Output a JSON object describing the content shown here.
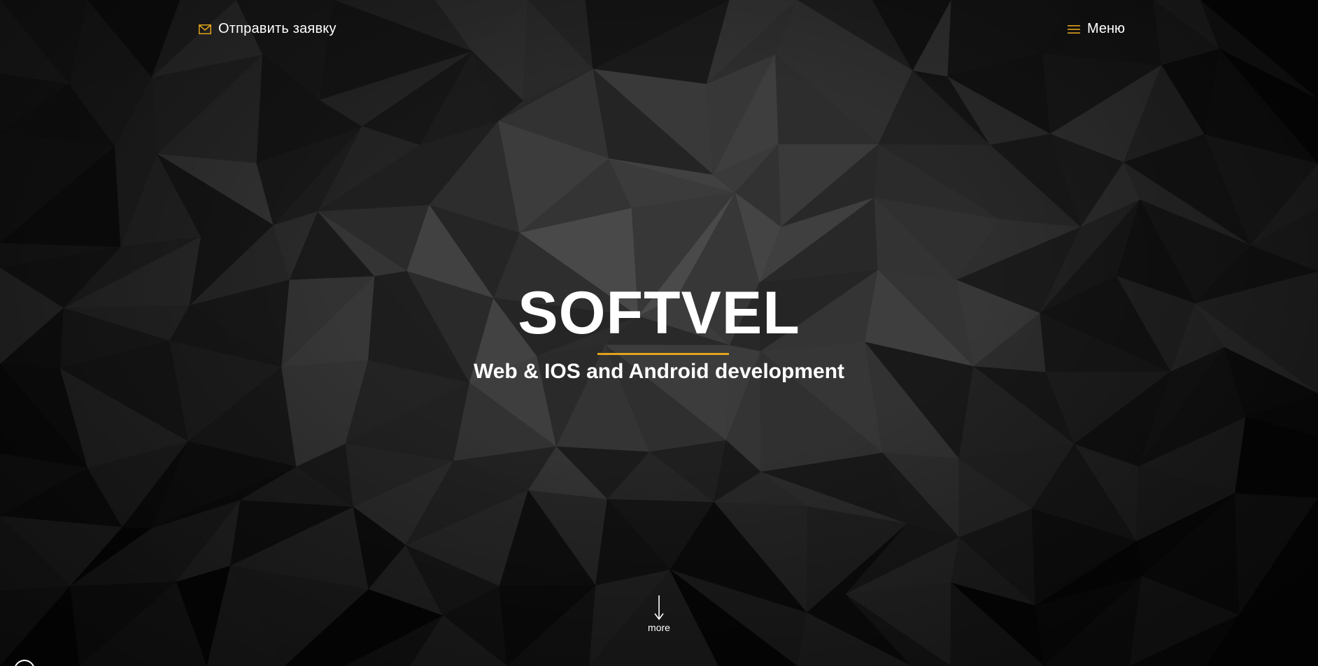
{
  "header": {
    "request_label": "Отправить заявку",
    "request_icon": "envelope-icon",
    "menu_label": "Меню",
    "menu_icon": "hamburger-icon"
  },
  "hero": {
    "brand": "SOFTVEL",
    "tagline": "Web & IOS and Android development",
    "more_label": "more",
    "more_icon": "arrow-down-icon"
  },
  "colors": {
    "accent": "#e0a31c",
    "text": "#ffffff",
    "background": "#1a1a1a"
  }
}
